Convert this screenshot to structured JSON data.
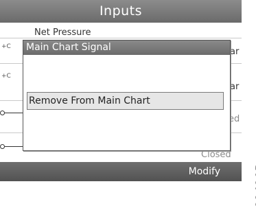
{
  "screen": {
    "title": "Inputs",
    "background_rows": [
      {
        "label": "Net Pressure",
        "unit_fragment": "ar"
      },
      {
        "unit_fragment": "ar"
      },
      {
        "status_fragment": "ed"
      },
      {
        "status": "Closed"
      }
    ],
    "row_symbols": [
      "+C",
      "+C"
    ]
  },
  "dialog": {
    "title": "Main Chart Signal",
    "items": [
      {
        "label": "Remove From Main Chart",
        "selected": true
      }
    ]
  },
  "footer": {
    "modify_label": "Modify"
  },
  "document_id": "82420D",
  "colors": {
    "title_bar": "#7a7a7a",
    "footer_bar": "#5e5e5e",
    "selection": "#e6e6e6"
  }
}
